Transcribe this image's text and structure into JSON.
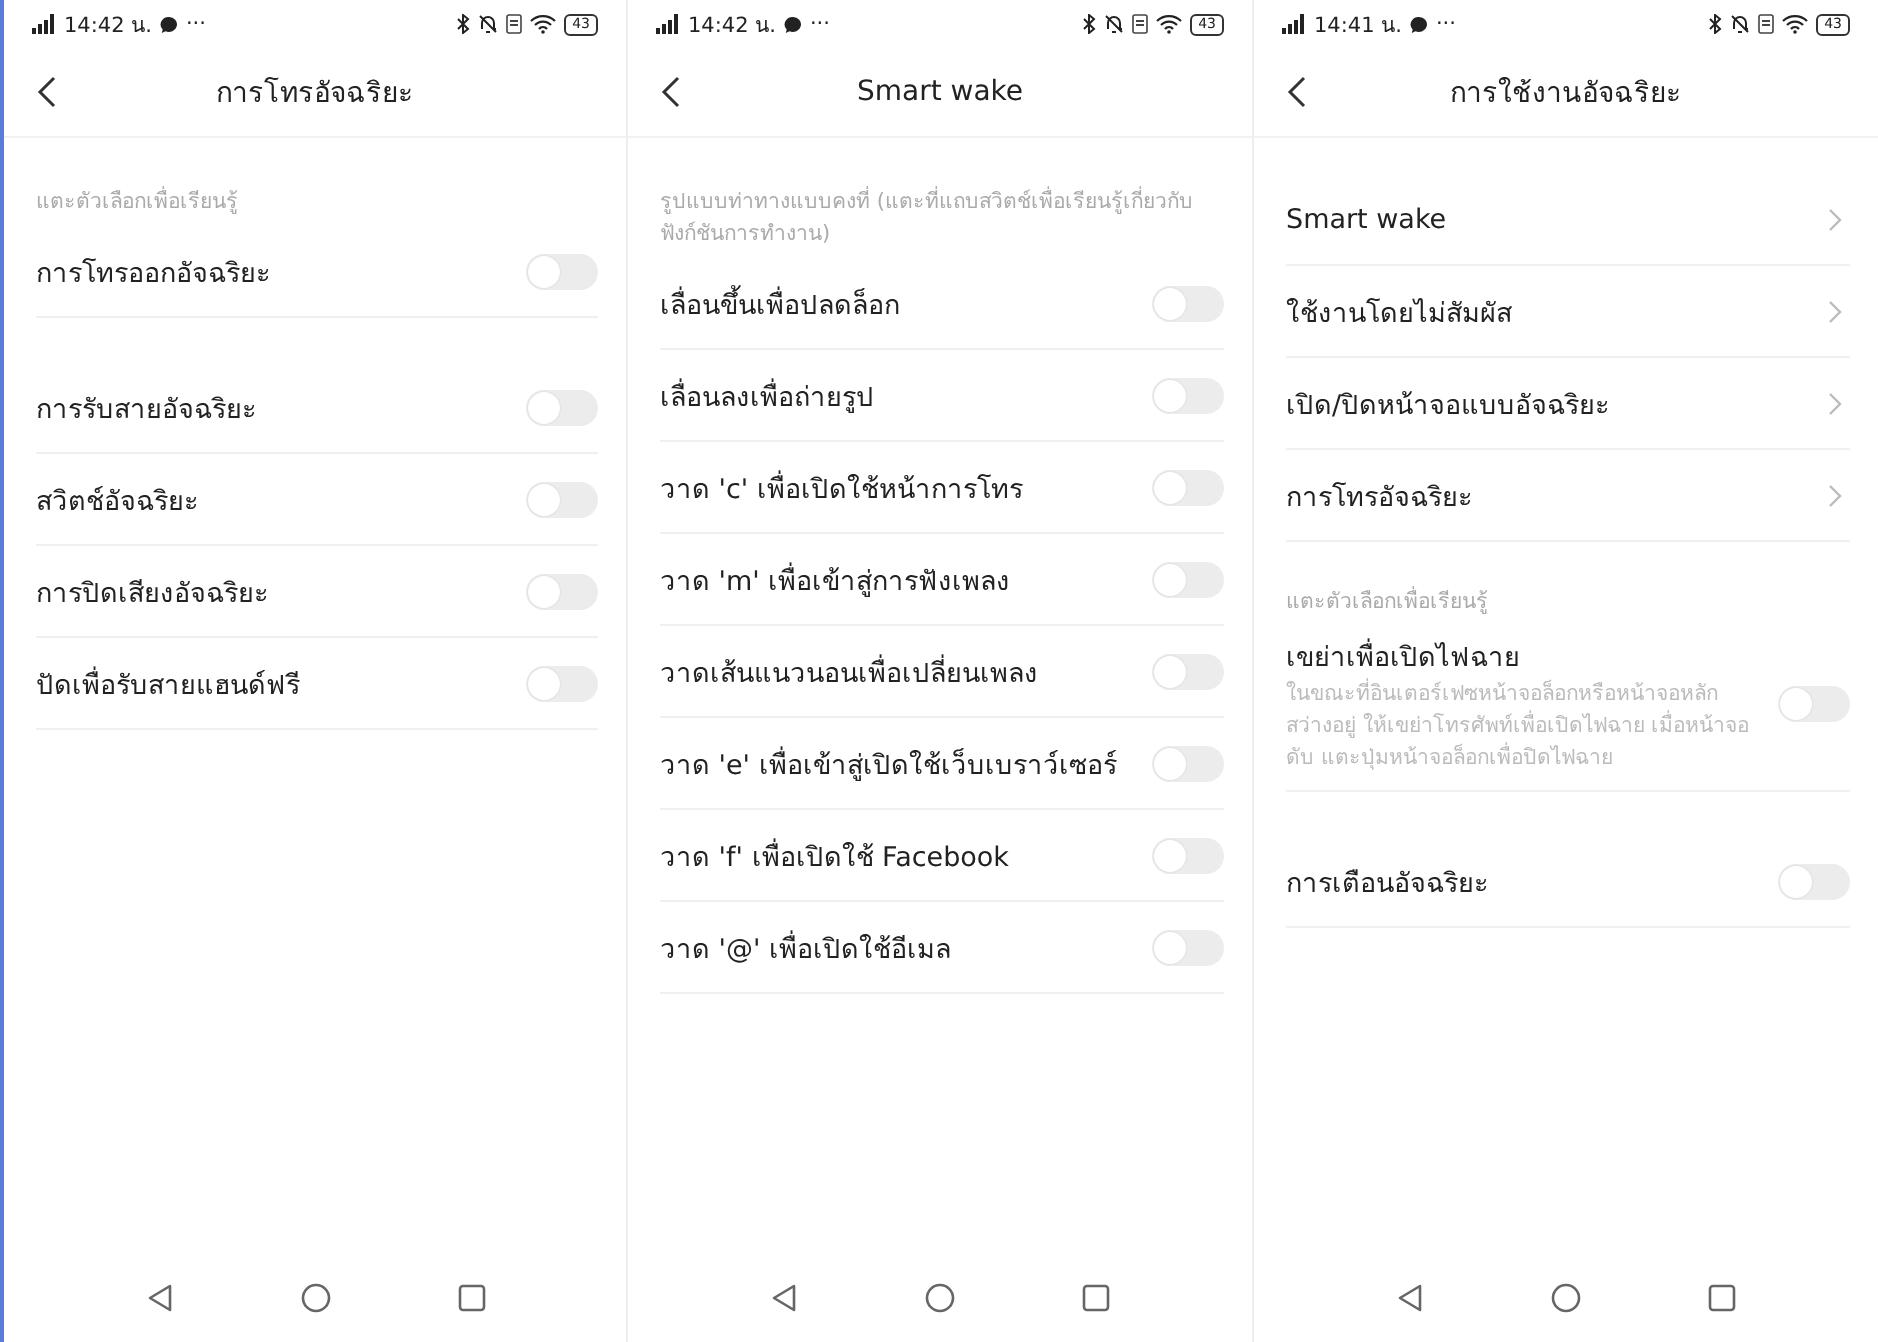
{
  "screens": [
    {
      "status_bar": {
        "time": "14:42 น.",
        "more": "···",
        "battery": "43"
      },
      "title": "การโทรอัจฉริยะ",
      "sections": [
        {
          "heading": "แตะตัวเลือกเพื่อเรียนรู้",
          "items": [
            {
              "kind": "toggle",
              "label": "การโทรออกอัจฉริยะ",
              "on": false
            }
          ]
        },
        {
          "items": [
            {
              "kind": "toggle",
              "label": "การรับสายอัจฉริยะ",
              "on": false
            },
            {
              "kind": "toggle",
              "label": "สวิตช์อัจฉริยะ",
              "on": false
            },
            {
              "kind": "toggle",
              "label": "การปิดเสียงอัจฉริยะ",
              "on": false
            },
            {
              "kind": "toggle",
              "label": "ปัดเพื่อรับสายแฮนด์ฟรี",
              "on": false
            }
          ]
        }
      ]
    },
    {
      "status_bar": {
        "time": "14:42 น.",
        "more": "···",
        "battery": "43"
      },
      "title": "Smart wake",
      "sections": [
        {
          "heading": "รูปแบบท่าทางแบบคงที่ (แตะที่แถบสวิตช์เพื่อเรียนรู้เกี่ยวกับฟังก์ชันการทำงาน)",
          "items": [
            {
              "kind": "toggle",
              "label": "เลื่อนขึ้นเพื่อปลดล็อก",
              "on": false
            },
            {
              "kind": "toggle",
              "label": "เลื่อนลงเพื่อถ่ายรูป",
              "on": false
            },
            {
              "kind": "toggle",
              "label": "วาด 'c' เพื่อเปิดใช้หน้าการโทร",
              "on": false
            },
            {
              "kind": "toggle",
              "label": "วาด 'm' เพื่อเข้าสู่การฟังเพลง",
              "on": false
            },
            {
              "kind": "toggle",
              "label": "วาดเส้นแนวนอนเพื่อเปลี่ยนเพลง",
              "on": false
            },
            {
              "kind": "toggle",
              "label": "วาด 'e' เพื่อเข้าสู่เปิดใช้เว็บเบราว์เซอร์",
              "on": false
            },
            {
              "kind": "toggle",
              "label": "วาด 'f' เพื่อเปิดใช้ Facebook",
              "on": false
            },
            {
              "kind": "toggle",
              "label": "วาด '@' เพื่อเปิดใช้อีเมล",
              "on": false
            }
          ]
        }
      ]
    },
    {
      "status_bar": {
        "time": "14:41 น.",
        "more": "···",
        "battery": "43"
      },
      "title": "การใช้งานอัจฉริยะ",
      "sections": [
        {
          "items": [
            {
              "kind": "link",
              "label": "Smart wake"
            },
            {
              "kind": "link",
              "label": "ใช้งานโดยไม่สัมผัส"
            },
            {
              "kind": "link",
              "label": "เปิด/ปิดหน้าจอแบบอัจฉริยะ"
            },
            {
              "kind": "link",
              "label": "การโทรอัจฉริยะ"
            }
          ]
        },
        {
          "heading": "แตะตัวเลือกเพื่อเรียนรู้",
          "items": [
            {
              "kind": "toggle",
              "label": "เขย่าเพื่อเปิดไฟฉาย",
              "description": "ในขณะที่อินเตอร์เฟซหน้าจอล็อกหรือหน้าจอหลักสว่างอยู่ ให้เขย่าโทรศัพท์เพื่อเปิดไฟฉาย เมื่อหน้าจอดับ แตะปุ่มหน้าจอล็อกเพื่อปิดไฟฉาย",
              "on": false
            }
          ]
        },
        {
          "items": [
            {
              "kind": "toggle",
              "label": "การเตือนอัจฉริยะ",
              "on": false
            }
          ]
        }
      ]
    }
  ]
}
